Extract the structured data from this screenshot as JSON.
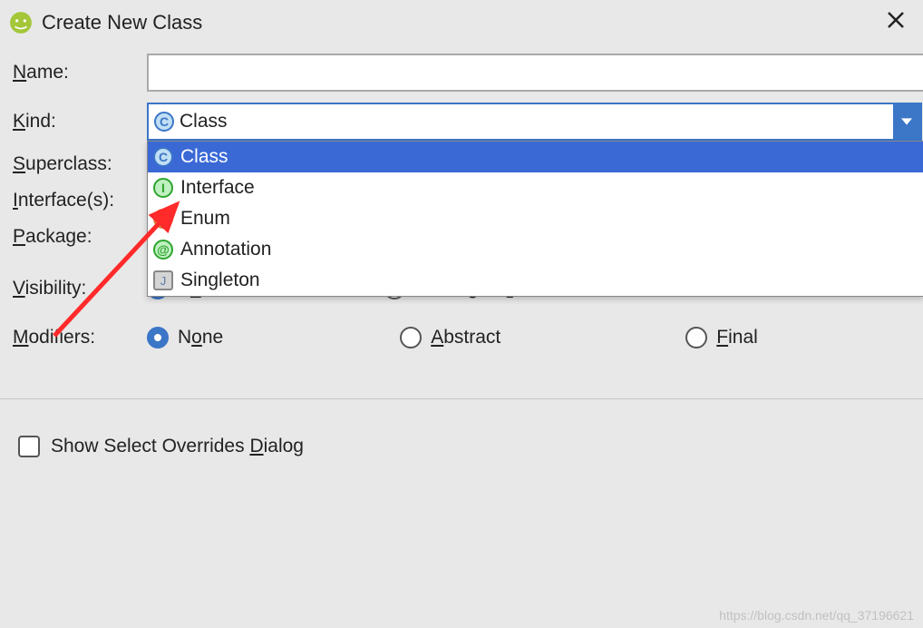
{
  "window": {
    "title": "Create New Class"
  },
  "fields": {
    "name": {
      "label": "Name:",
      "mnemonic": "N",
      "value": ""
    },
    "kind": {
      "label": "Kind:",
      "mnemonic": "K",
      "selected_index": 0,
      "options": [
        {
          "icon": "C",
          "icon_class": "ic-c",
          "label": "Class"
        },
        {
          "icon": "I",
          "icon_class": "ic-i",
          "label": "Interface"
        },
        {
          "icon": "E",
          "icon_class": "ic-e",
          "label": "Enum"
        },
        {
          "icon": "@",
          "icon_class": "ic-a",
          "label": "Annotation"
        },
        {
          "icon": "J",
          "icon_class": "ic-j",
          "label": "Singleton"
        }
      ]
    },
    "superclass": {
      "label": "Superclass:",
      "mnemonic": "S"
    },
    "interfaces": {
      "label": "Interface(s):",
      "mnemonic": "I"
    },
    "package": {
      "label": "Package:",
      "mnemonic": "P"
    },
    "visibility": {
      "label": "Visibility:",
      "mnemonic": "V",
      "options": [
        {
          "label": "Public",
          "mnemonic": "u",
          "checked": true
        },
        {
          "label": "Package Private",
          "mnemonic": "r",
          "checked": false
        }
      ]
    },
    "modifiers": {
      "label": "Modifiers:",
      "mnemonic": "M",
      "options": [
        {
          "label": "None",
          "mnemonic": "o",
          "checked": true
        },
        {
          "label": "Abstract",
          "mnemonic": "A",
          "checked": false
        },
        {
          "label": "Final",
          "mnemonic": "F",
          "checked": false
        }
      ]
    }
  },
  "checkbox": {
    "label": "Show Select Overrides Dialog",
    "mnemonic": "D",
    "checked": false
  },
  "watermark": "https://blog.csdn.net/qq_37196621"
}
